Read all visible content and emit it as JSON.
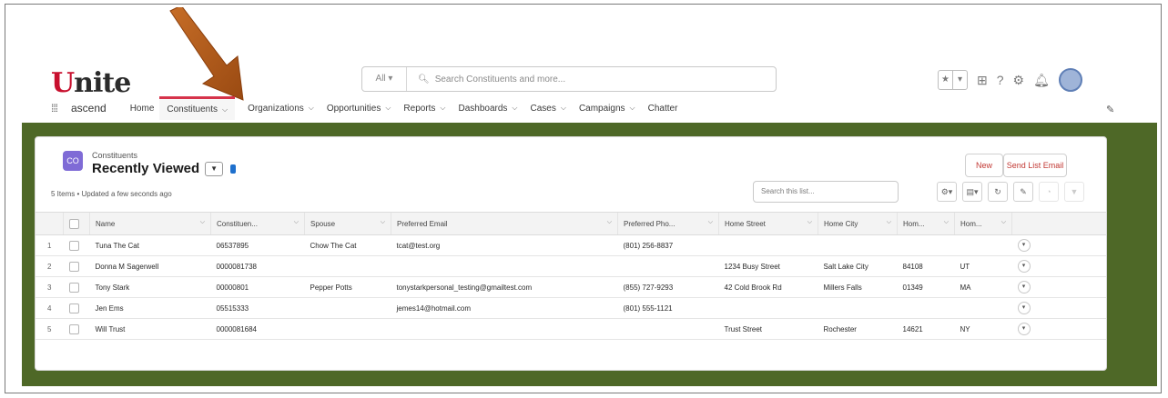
{
  "header": {
    "logo_initial": "U",
    "logo_rest": "nite",
    "search": {
      "scope": "All ▾",
      "placeholder": "Search Constituents and more..."
    }
  },
  "nav": {
    "app_name": "ascend",
    "items": [
      {
        "label": "Home",
        "has_menu": false
      },
      {
        "label": "Constituents",
        "has_menu": true,
        "active": true
      },
      {
        "label": "Organizations",
        "has_menu": true
      },
      {
        "label": "Opportunities",
        "has_menu": true
      },
      {
        "label": "Reports",
        "has_menu": true
      },
      {
        "label": "Dashboards",
        "has_menu": true
      },
      {
        "label": "Cases",
        "has_menu": true
      },
      {
        "label": "Campaigns",
        "has_menu": true
      },
      {
        "label": "Chatter",
        "has_menu": false
      }
    ]
  },
  "list_view": {
    "object_icon_text": "CO",
    "object_type": "Constituents",
    "title": "Recently Viewed",
    "meta": "5 Items • Updated a few seconds ago",
    "new_button": "New",
    "send_email_button": "Send List Email",
    "search_placeholder": "Search this list...",
    "columns": [
      "Name",
      "Constituen...",
      "Spouse",
      "Preferred Email",
      "Preferred Pho...",
      "Home Street",
      "Home City",
      "Hom...",
      "Hom..."
    ],
    "rows": [
      {
        "n": "1",
        "name": "Tuna The Cat",
        "id": "06537895",
        "spouse": "Chow The Cat",
        "email": "tcat@test.org",
        "phone": "(801) 256-8837",
        "street": "",
        "city": "",
        "zip": "",
        "state": ""
      },
      {
        "n": "2",
        "name": "Donna M Sagerwell",
        "id": "0000081738",
        "spouse": "",
        "email": "",
        "phone": "",
        "street": "1234 Busy Street",
        "city": "Salt Lake City",
        "zip": "84108",
        "state": "UT"
      },
      {
        "n": "3",
        "name": "Tony Stark",
        "id": "00000801",
        "spouse": "Pepper Potts",
        "email": "tonystarkpersonal_testing@gmailtest.com",
        "phone": "(855) 727-9293",
        "street": "42 Cold Brook Rd",
        "city": "Millers Falls",
        "zip": "01349",
        "state": "MA"
      },
      {
        "n": "4",
        "name": "Jen Ems",
        "id": "05515333",
        "spouse": "",
        "email": "jemes14@hotmail.com",
        "phone": "(801) 555-1121",
        "street": "",
        "city": "",
        "zip": "",
        "state": ""
      },
      {
        "n": "5",
        "name": "Will Trust",
        "id": "0000081684",
        "spouse": "",
        "email": "",
        "phone": "",
        "street": "Trust Street",
        "city": "Rochester",
        "zip": "14621",
        "state": "NY"
      }
    ]
  },
  "colors": {
    "accent_red": "#c8102e",
    "annotation_arrow": "#b85a1a",
    "frame_green": "#4e6827",
    "link_blue": "#1b63c2"
  }
}
